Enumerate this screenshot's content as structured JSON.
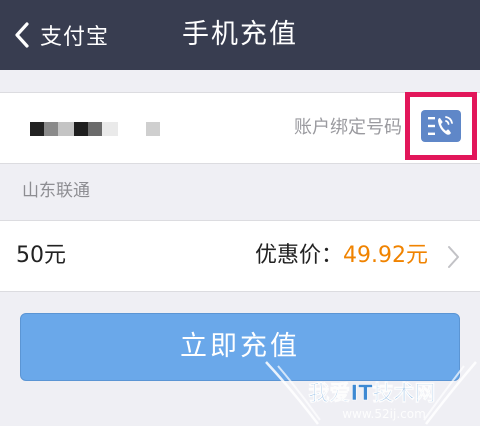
{
  "header": {
    "back_label": "支付宝",
    "title": "手机充值"
  },
  "phone": {
    "hint": "账户绑定号码",
    "contact_icon": "phone-contact-icon"
  },
  "carrier": "山东联通",
  "amount": {
    "face_value": "50元",
    "price_label": "优惠价：",
    "price_value": "49.92元"
  },
  "recharge_button": "立即充值",
  "watermark": {
    "main": "我爱IT技术网",
    "url": "www.52ij.com"
  },
  "colors": {
    "header_bg": "#383d50",
    "price_orange": "#f08300",
    "button_blue": "#6aa8ea",
    "highlight_pink": "#e2165a",
    "icon_blue": "#5f87c8"
  }
}
